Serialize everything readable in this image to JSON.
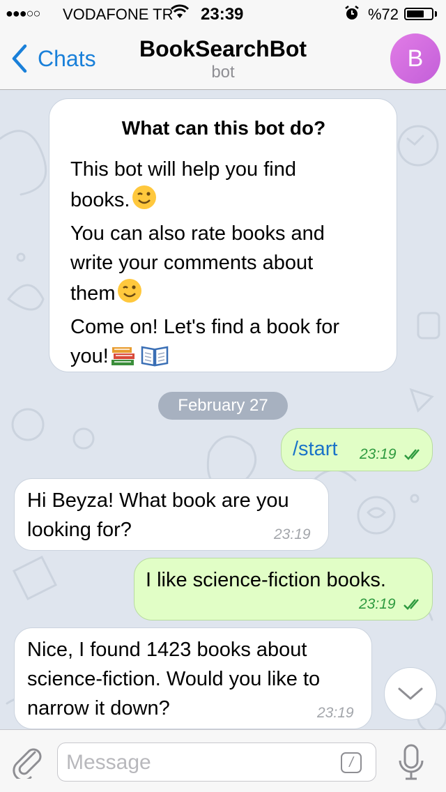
{
  "status_bar": {
    "carrier": "VODAFONE TR",
    "time": "23:39",
    "battery": "%72",
    "battery_level": 0.72
  },
  "nav": {
    "back_label": "Chats",
    "title": "BookSearchBot",
    "subtitle": "bot",
    "avatar_letter": "B"
  },
  "bot_info": {
    "title": "What can this bot do?",
    "line1": "This bot will help you find",
    "line2": "books.",
    "line3": "You can also rate books and",
    "line4": "write your comments about",
    "line5": "them",
    "line6": "Come on! Let's find a book for",
    "line7": "you!"
  },
  "date_separator": "February 27",
  "messages": [
    {
      "direction": "out",
      "lines": [
        "/start"
      ],
      "time": "23:19",
      "read": true
    },
    {
      "direction": "in",
      "lines": [
        "Hi Beyza! What book are you",
        "looking for?"
      ],
      "time": "23:19"
    },
    {
      "direction": "out",
      "lines": [
        "I like science-fiction books."
      ],
      "time": "23:19",
      "read": true
    },
    {
      "direction": "in",
      "lines": [
        "Nice, I found 1423 books about",
        "science-fiction. Would you like to",
        "narrow it down?"
      ],
      "time": "23:19"
    }
  ],
  "input": {
    "placeholder": "Message",
    "command_symbol": "/"
  },
  "colors": {
    "accent": "#1a80d9",
    "chat_background": "#dfe5ee",
    "outgoing_bubble": "#e1fec6",
    "incoming_bubble": "#ffffff",
    "outgoing_time": "#2e9a3f",
    "avatar": "#d56de0"
  },
  "icons": {
    "back": "chevron-left-icon",
    "attach": "paperclip-icon",
    "command": "slash-command-icon",
    "mic": "microphone-icon",
    "scroll": "chevron-down-icon",
    "read": "double-check-icon",
    "wink": "winking-face-emoji",
    "books": "books-emoji",
    "open_book": "open-book-emoji"
  }
}
